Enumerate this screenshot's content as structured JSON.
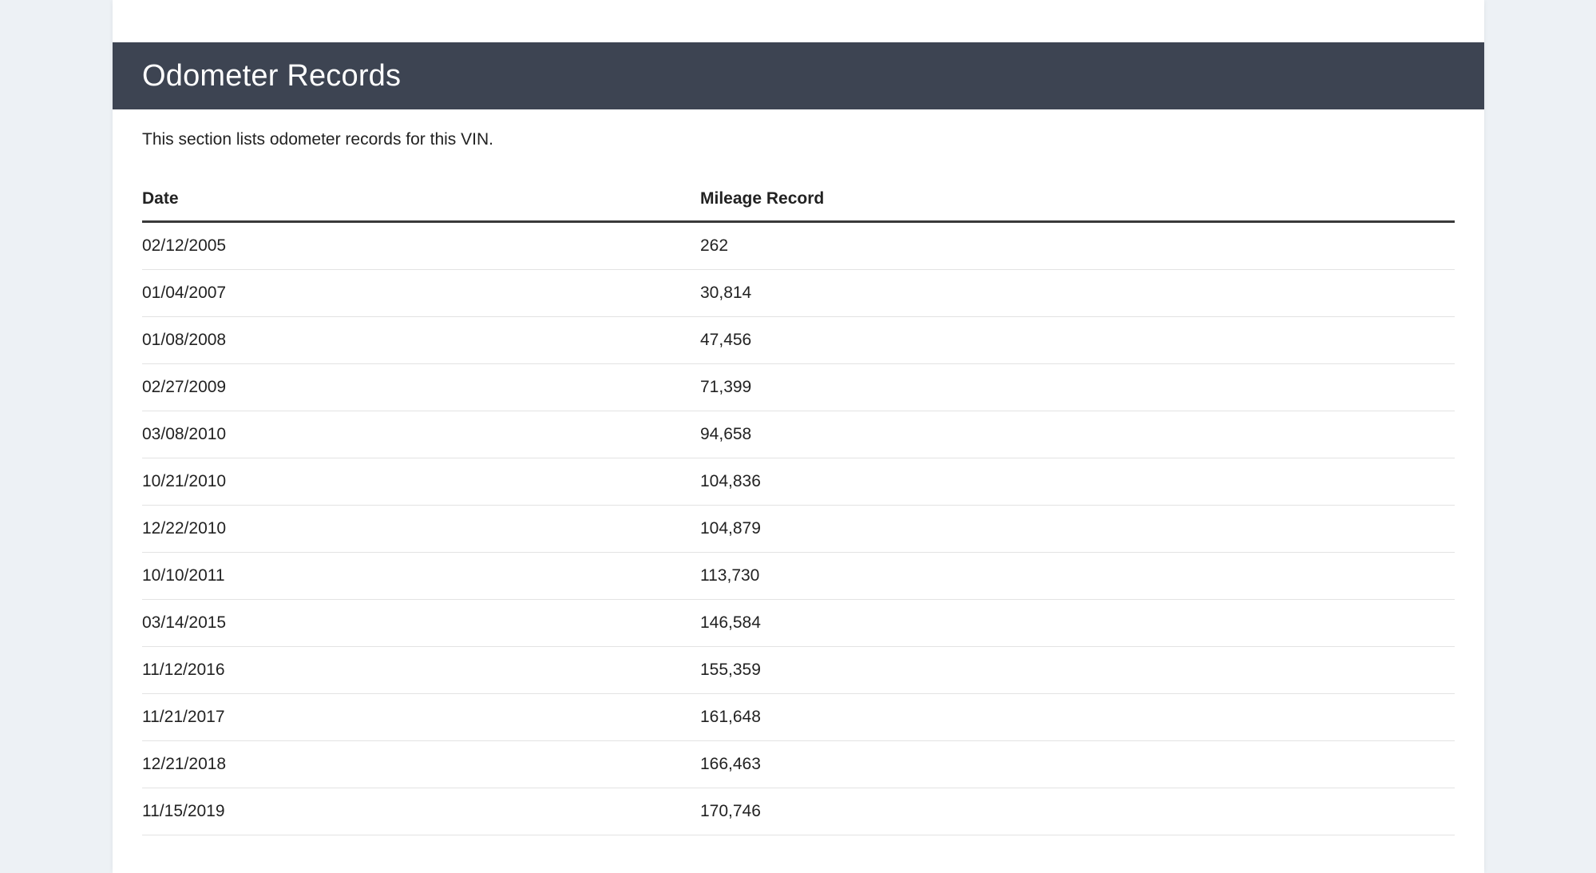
{
  "section": {
    "title": "Odometer Records",
    "description": "This section lists odometer records for this VIN."
  },
  "table": {
    "headers": {
      "date": "Date",
      "mileage": "Mileage Record"
    },
    "rows": [
      {
        "date": "02/12/2005",
        "mileage": "262"
      },
      {
        "date": "01/04/2007",
        "mileage": "30,814"
      },
      {
        "date": "01/08/2008",
        "mileage": "47,456"
      },
      {
        "date": "02/27/2009",
        "mileage": "71,399"
      },
      {
        "date": "03/08/2010",
        "mileage": "94,658"
      },
      {
        "date": "10/21/2010",
        "mileage": "104,836"
      },
      {
        "date": "12/22/2010",
        "mileage": "104,879"
      },
      {
        "date": "10/10/2011",
        "mileage": "113,730"
      },
      {
        "date": "03/14/2015",
        "mileage": "146,584"
      },
      {
        "date": "11/12/2016",
        "mileage": "155,359"
      },
      {
        "date": "11/21/2017",
        "mileage": "161,648"
      },
      {
        "date": "12/21/2018",
        "mileage": "166,463"
      },
      {
        "date": "11/15/2019",
        "mileage": "170,746"
      }
    ]
  },
  "colors": {
    "header_background": "#3d4452",
    "page_background": "#edf1f5",
    "card_background": "#ffffff"
  }
}
